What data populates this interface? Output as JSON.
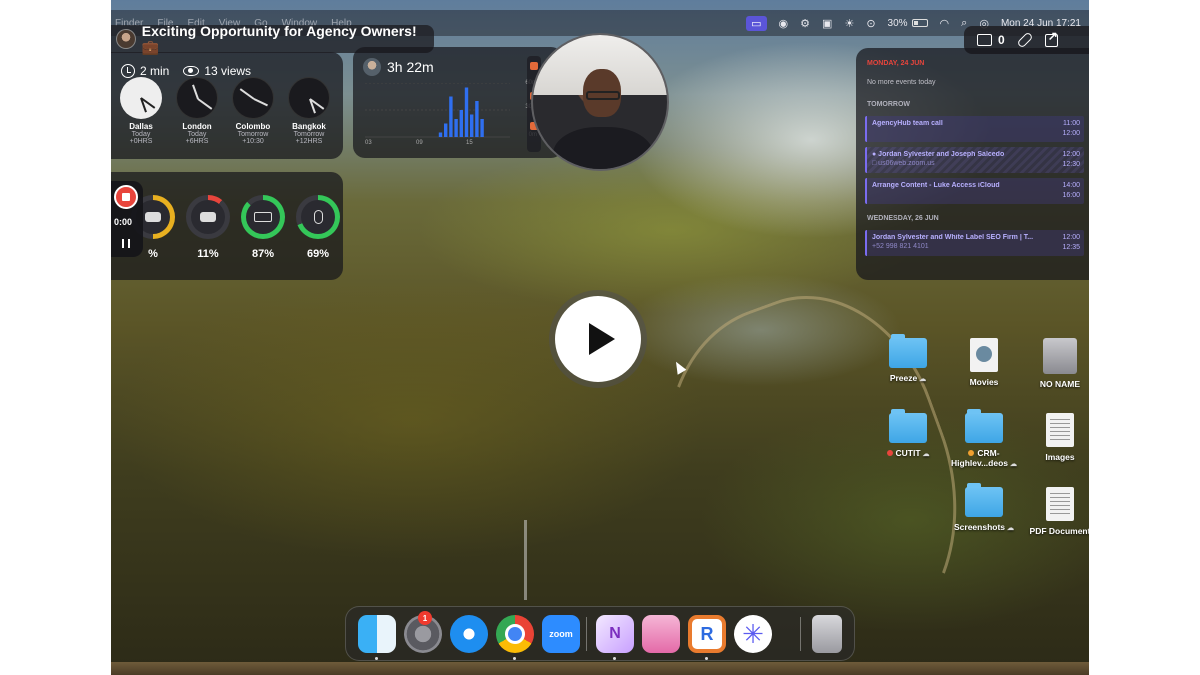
{
  "menubar": {
    "left_items": [
      "Finder",
      "File",
      "Edit",
      "View",
      "Go",
      "Window",
      "Help"
    ],
    "battery_percent": "30%",
    "datetime": "Mon 24 Jun  17:21",
    "icons": [
      "screen-record-icon",
      "grammarly-icon",
      "control-icon",
      "messages-icon",
      "brightness-icon",
      "play-circle-icon",
      "battery-icon",
      "wifi-icon",
      "search-icon",
      "control-center-icon",
      "siri-icon"
    ]
  },
  "video": {
    "title": "Exciting Opportunity for Agency Owners! 💼",
    "duration": "2 min",
    "views": "13 views",
    "comment_count": "0"
  },
  "world_clock": {
    "clocks": [
      {
        "city": "Dallas",
        "day": "Today",
        "offset": "+0HRS",
        "hour": 5,
        "minute": 21,
        "dark": false
      },
      {
        "city": "London",
        "day": "Today",
        "offset": "+6HRS",
        "hour": 11,
        "minute": 21,
        "dark": true
      },
      {
        "city": "Colombo",
        "day": "Tomorrow",
        "offset": "+10:30",
        "hour": 3,
        "minute": 51,
        "dark": true
      },
      {
        "city": "Bangkok",
        "day": "Tomorrow",
        "offset": "+12HRS",
        "hour": 5,
        "minute": 21,
        "dark": true
      }
    ]
  },
  "screen_time": {
    "total": "3h 22m",
    "y_labels": [
      "60m",
      "30m",
      "0m"
    ],
    "x_labels": [
      "03",
      "09",
      "15"
    ],
    "bars": [
      0,
      0,
      0,
      0,
      0,
      0,
      0,
      0,
      0,
      0,
      0,
      0,
      0,
      0,
      5,
      15,
      45,
      20,
      30,
      55,
      25,
      40,
      20,
      0
    ]
  },
  "batteries": {
    "items": [
      {
        "label": "%",
        "level": 0.5,
        "color": "#e8b020",
        "device": "headphones-icon"
      },
      {
        "label": "11%",
        "level": 0.11,
        "color": "#e8453c",
        "device": "case-icon"
      },
      {
        "label": "87%",
        "level": 0.87,
        "color": "#34c759",
        "device": "keyboard-icon"
      },
      {
        "label": "69%",
        "level": 0.69,
        "color": "#34c759",
        "device": "mouse-icon"
      }
    ]
  },
  "recorder": {
    "time": "0:00"
  },
  "calendar": {
    "date_header": "MONDAY, 24 JUN",
    "no_events": "No more events today",
    "tomorrow_label": "TOMORROW",
    "wednesday_label": "WEDNESDAY, 26 JUN",
    "events": [
      {
        "title": "AgencyHub team call",
        "sub": "",
        "start": "11:00",
        "end": "12:00"
      },
      {
        "title": "● Jordan Sylvester and Joseph Salcedo",
        "sub": "□ us06web.zoom.us",
        "start": "12:00",
        "end": "12:30"
      },
      {
        "title": "Arrange Content - Luke Access iCloud",
        "sub": "",
        "start": "14:00",
        "end": "16:00"
      },
      {
        "title": "Jordan Sylvester and White Label SEO Firm | T...",
        "sub": "+52 998 821 4101",
        "start": "12:00",
        "end": "12:35"
      }
    ]
  },
  "desktop": {
    "items": [
      {
        "label": "Preeze",
        "kind": "folder",
        "cloud": true,
        "tag": ""
      },
      {
        "label": "Movies",
        "kind": "movie",
        "cloud": false,
        "tag": ""
      },
      {
        "label": "NO NAME",
        "kind": "disk",
        "cloud": false,
        "tag": ""
      },
      {
        "label": "CUTIT",
        "kind": "folder",
        "cloud": true,
        "tag": "#e8453c"
      },
      {
        "label": "CRM-Highlev...deos",
        "kind": "folder",
        "cloud": true,
        "tag": "#f0a030"
      },
      {
        "label": "Images",
        "kind": "doc",
        "cloud": false,
        "tag": ""
      },
      {
        "label": "Screenshots",
        "kind": "folder",
        "cloud": true,
        "tag": ""
      },
      {
        "label": "PDF Document",
        "kind": "doc",
        "cloud": false,
        "tag": ""
      }
    ]
  },
  "dock": {
    "apps": [
      "finder-icon",
      "system-settings-icon",
      "safari-icon",
      "chrome-icon",
      "zoom-icon",
      "onenote-icon",
      "screen-app-icon",
      "r-app-icon",
      "star-app-icon",
      "trash-icon"
    ],
    "zoom_label": "zoom",
    "onenote_label": "N",
    "r_label": "R",
    "star_label": "✳",
    "settings_badge": "1"
  }
}
